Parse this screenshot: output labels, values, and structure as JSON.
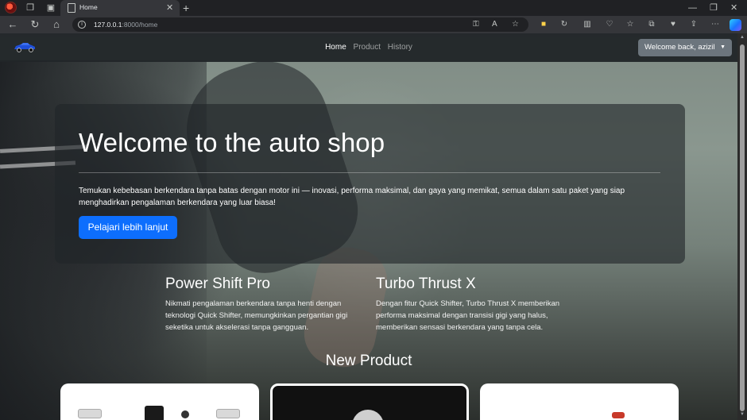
{
  "browser": {
    "tab_title": "Home",
    "url_host": "127.0.0.1",
    "url_rest": ":8000/home",
    "new_tab": "+",
    "tab_close": "✕"
  },
  "navbar": {
    "links": [
      "Home",
      "Product",
      "History"
    ],
    "user_button": "Welcome back, azizil"
  },
  "hero": {
    "title": "Welcome to the auto shop",
    "text": "Temukan kebebasan berkendara tanpa batas dengan motor ini — inovasi, performa maksimal, dan gaya yang memikat, semua dalam satu paket yang siap menghadirkan pengalaman berkendara yang luar biasa!",
    "button": "Pelajari lebih lanjut"
  },
  "features": [
    {
      "title": "Power Shift Pro",
      "text": "Nikmati pengalaman berkendara tanpa henti dengan teknologi Quick Shifter, memungkinkan pergantian gigi seketika untuk akselerasi tanpa gangguan."
    },
    {
      "title": "Turbo Thrust X",
      "text": "Dengan fitur Quick Shifter, Turbo Thrust X memberikan performa maksimal dengan transisi gigi yang halus, memberikan sensasi berkendara yang tanpa cela."
    }
  ],
  "new_product": {
    "heading": "New Product"
  },
  "colors": {
    "primary": "#0d6efd",
    "navbar": "#212529",
    "user_button": "#6c757d"
  }
}
